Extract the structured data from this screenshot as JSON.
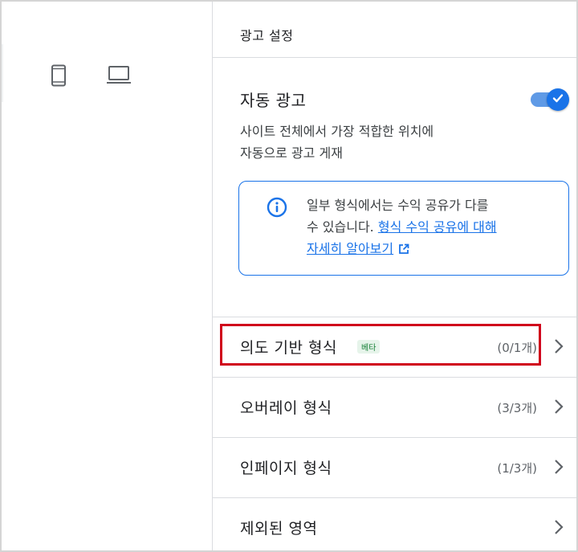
{
  "panel": {
    "title": "광고 설정"
  },
  "auto_ads": {
    "title": "자동 광고",
    "description_line1": "사이트 전체에서 가장 적합한 위치에",
    "description_line2": "자동으로 광고 게재",
    "toggle_on": true
  },
  "info": {
    "text_line1": "일부 형식에서는 수익 공유가 다를",
    "text_line2_prefix": "수 있습니다. ",
    "link_part1": "형식 수익 공유에 대해",
    "link_part2": "자세히 알아보기"
  },
  "rows": [
    {
      "label": "의도 기반 형식",
      "badge": "베타",
      "count": "(0/1개)",
      "highlighted": true
    },
    {
      "label": "오버레이 형식",
      "count": "(3/3개)"
    },
    {
      "label": "인페이지 형식",
      "count": "(1/3개)"
    },
    {
      "label": "제외된 영역"
    }
  ],
  "colors": {
    "accent_blue": "#1a73e8",
    "highlight_red": "#d0021b",
    "badge_green": "#188038"
  },
  "icons": [
    "phone-icon",
    "laptop-icon",
    "check-icon",
    "info-icon",
    "external-link-icon",
    "chevron-right-icon"
  ]
}
